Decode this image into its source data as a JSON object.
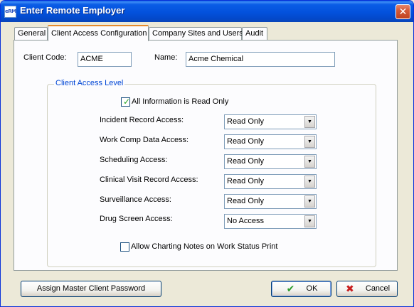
{
  "window": {
    "title": "Enter Remote Employer",
    "app_icon_text": "eRM",
    "close_glyph": "✕"
  },
  "tabs": [
    {
      "label": "General"
    },
    {
      "label": "Client Access Configuration"
    },
    {
      "label": "Company Sites and Users"
    },
    {
      "label": "Audit"
    }
  ],
  "client": {
    "code_label": "Client Code:",
    "code_value": "ACME",
    "name_label": "Name:",
    "name_value": "Acme Chemical"
  },
  "access_level": {
    "caption": "Client Access Level",
    "read_only_label": "All Information is Read Only",
    "read_only_checked": true,
    "rows": [
      {
        "label": "Incident Record Access:",
        "value": "Read Only"
      },
      {
        "label": "Work Comp Data Access:",
        "value": "Read Only"
      },
      {
        "label": "Scheduling Access:",
        "value": "Read Only"
      },
      {
        "label": "Clinical Visit Record Access:",
        "value": "Read Only"
      },
      {
        "label": "Surveillance Access:",
        "value": "Read Only"
      },
      {
        "label": "Drug Screen Access:",
        "value": "No Access"
      }
    ],
    "charting_label": "Allow Charting Notes on Work Status Print",
    "charting_checked": false
  },
  "buttons": {
    "assign_password": "Assign Master Client Password",
    "ok": "OK",
    "cancel": "Cancel"
  },
  "colors": {
    "titlebar": "#0a5ce6",
    "group_caption": "#0046d5",
    "ok_icon": "#2c9c2c",
    "cancel_icon": "#c81e1e"
  }
}
